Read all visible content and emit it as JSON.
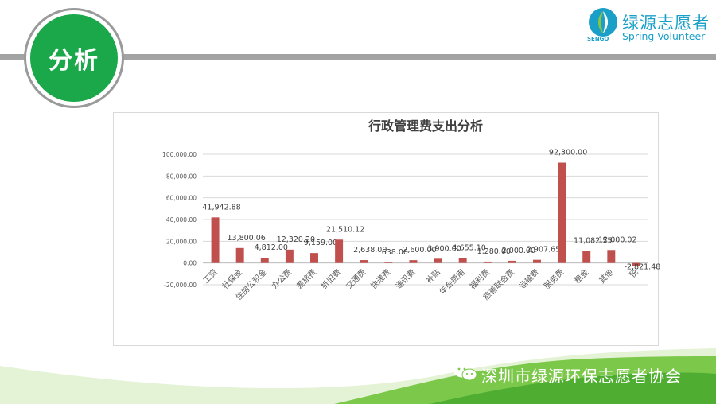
{
  "slide": {
    "badge_label": "分析",
    "logo": {
      "name_cn": "绿源志愿者",
      "name_en": "Spring Volunteer",
      "mark_text": "SENGO",
      "icon": "leaf-drop-logo-icon"
    },
    "footer": {
      "text": "深圳市绿源环保志愿者协会",
      "icon": "wechat-icon"
    },
    "colors": {
      "accent_green": "#1aa84a",
      "band_gray": "#a3a3a3",
      "bar_red": "#c0504d",
      "logo_blue": "#1aa0c8",
      "wave_green": "#7cc84a"
    }
  },
  "chart_data": {
    "type": "bar",
    "title": "行政管理费支出分析",
    "categories": [
      "工资",
      "社保金",
      "住房公积金",
      "办公费",
      "差旅费",
      "折旧费",
      "交通费",
      "快递费",
      "通讯费",
      "补贴",
      "年会费用",
      "福利费",
      "慈善联会费",
      "运输费",
      "服务费",
      "租金",
      "其他",
      "税"
    ],
    "values": [
      41942.88,
      13800.06,
      4812.0,
      12320.2,
      9159.0,
      21510.12,
      2638.0,
      638.0,
      2600.0,
      3900.0,
      4655.1,
      1280.0,
      2000.0,
      2907.65,
      92300.0,
      11082.55,
      12000.02,
      -2821.48
    ],
    "value_labels": [
      "41,942.88",
      "13,800.06",
      "4,812.00",
      "12,320.20",
      "9,159.00",
      "21,510.12",
      "2,638.00",
      "638.00",
      "2,600.00",
      "3,900.00",
      "4,655.10",
      "1,280.00",
      "2,000.00",
      "2,907.65",
      "92,300.00",
      "11,082.55",
      "12,000.02",
      "-2,821.48"
    ],
    "y_ticks": [
      "-20,000.00",
      "0.00",
      "20,000.00",
      "40,000.00",
      "60,000.00",
      "80,000.00",
      "100,000.00"
    ],
    "ylim": [
      -20000,
      100000
    ],
    "grid": true,
    "legend": "none",
    "xlabel": "",
    "ylabel": ""
  }
}
